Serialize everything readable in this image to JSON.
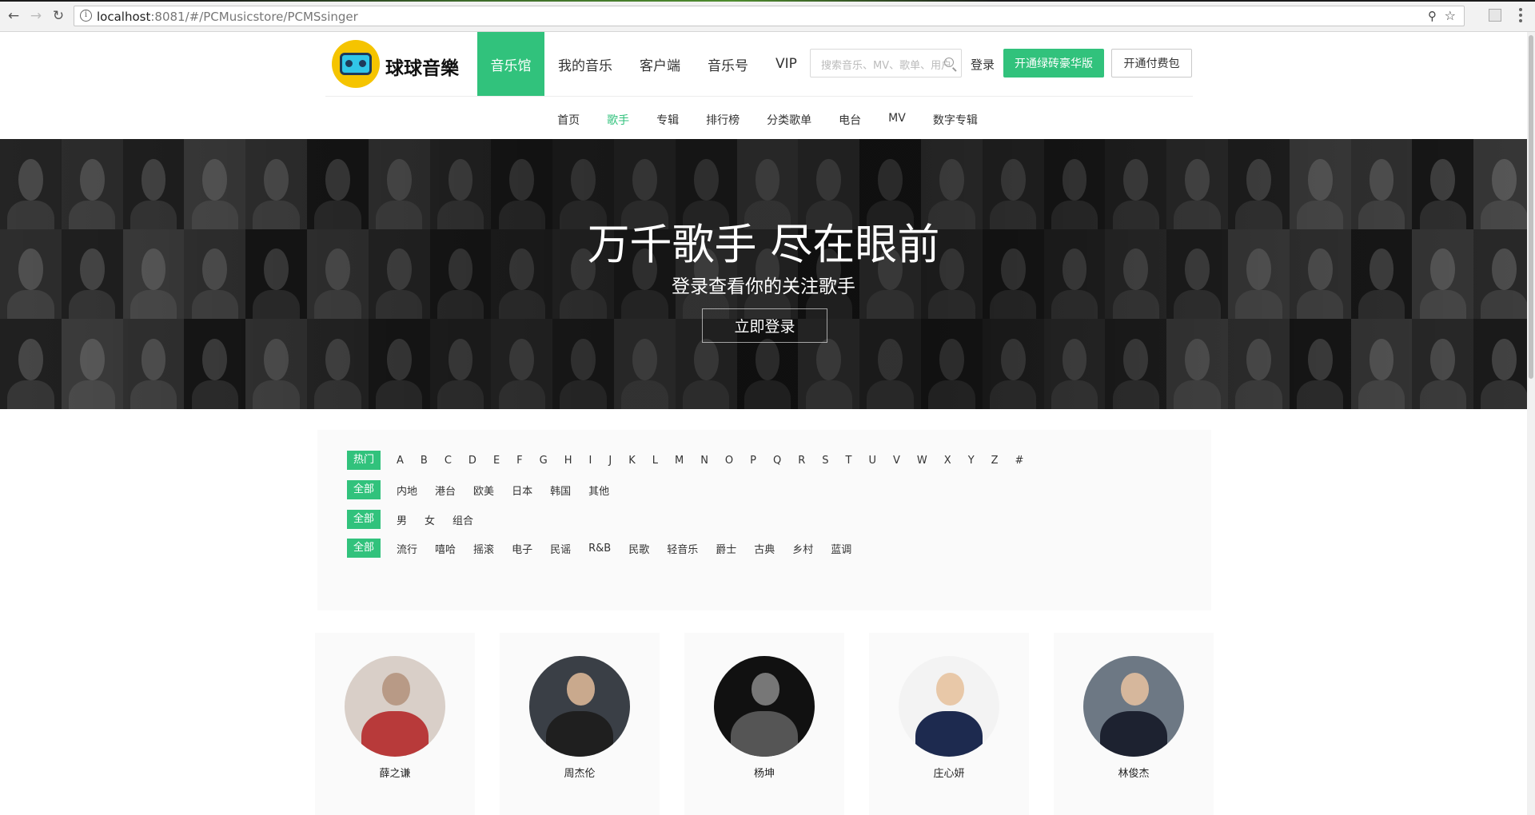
{
  "browser": {
    "url_host": "localhost",
    "url_rest": ":8081/#/PCMusicstore/PCMSsinger"
  },
  "brand": {
    "name": "球球音樂",
    "accent": "#31c27c",
    "logo_yellow": "#f5c400"
  },
  "main_nav": [
    {
      "label": "音乐馆",
      "active": true
    },
    {
      "label": "我的音乐"
    },
    {
      "label": "客户端"
    },
    {
      "label": "音乐号"
    },
    {
      "label": "VIP"
    }
  ],
  "search": {
    "placeholder": "搜索音乐、MV、歌单、用户"
  },
  "account": {
    "login": "登录",
    "vip_button": "开通绿砖豪华版",
    "pay_button": "开通付费包"
  },
  "sub_nav": [
    {
      "label": "首页"
    },
    {
      "label": "歌手",
      "active": true
    },
    {
      "label": "专辑"
    },
    {
      "label": "排行榜"
    },
    {
      "label": "分类歌单"
    },
    {
      "label": "电台"
    },
    {
      "label": "MV"
    },
    {
      "label": "数字专辑"
    }
  ],
  "banner": {
    "title": "万千歌手 尽在眼前",
    "subtitle": "登录查看你的关注歌手",
    "button": "立即登录"
  },
  "filters": {
    "letters": [
      "热门",
      "A",
      "B",
      "C",
      "D",
      "E",
      "F",
      "G",
      "H",
      "I",
      "J",
      "K",
      "L",
      "M",
      "N",
      "O",
      "P",
      "Q",
      "R",
      "S",
      "T",
      "U",
      "V",
      "W",
      "X",
      "Y",
      "Z",
      "#"
    ],
    "regions": [
      "全部",
      "内地",
      "港台",
      "欧美",
      "日本",
      "韩国",
      "其他"
    ],
    "genders": [
      "全部",
      "男",
      "女",
      "组合"
    ],
    "genres": [
      "全部",
      "流行",
      "嘻哈",
      "摇滚",
      "电子",
      "民谣",
      "R&B",
      "民歌",
      "轻音乐",
      "爵士",
      "古典",
      "乡村",
      "蓝调"
    ]
  },
  "singers": [
    {
      "name": "薛之谦",
      "bg": "#d9cfc8",
      "head": "#b89a86",
      "body": "#b83a3a"
    },
    {
      "name": "周杰伦",
      "bg": "#3a3f46",
      "head": "#c9a98d",
      "body": "#1f1f1f"
    },
    {
      "name": "杨坤",
      "bg": "#111111",
      "head": "#777777",
      "body": "#555555"
    },
    {
      "name": "庄心妍",
      "bg": "#f3f3f3",
      "head": "#e8c8a8",
      "body": "#1d2a4f"
    },
    {
      "name": "林俊杰",
      "bg": "#6d7884",
      "head": "#d6b79c",
      "body": "#1d2230"
    }
  ]
}
